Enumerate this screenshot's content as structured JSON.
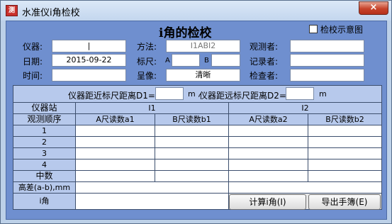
{
  "window": {
    "title": "水准仪i角检校",
    "icon": "app-logo-icon",
    "close_label": "×"
  },
  "form": {
    "title": "i角的检校",
    "diagram_checkbox_label": "检校示意图",
    "instrument_label": "仪器:",
    "instrument_value": "|",
    "method_label": "方法:",
    "method_value": "I1ABI2",
    "observer_label": "观测者:",
    "observer_value": "",
    "date_label": "日期:",
    "date_value": "2015-09-22",
    "staff_label": "标尺:",
    "staff_a_label": "A",
    "staff_a_value": "",
    "staff_b_label": "B",
    "staff_b_value": "",
    "recorder_label": "记录者:",
    "recorder_value": "",
    "time_label": "时间:",
    "time_value": "",
    "image_label": "呈像:",
    "image_value": "清晰",
    "checker_label": "检查者:",
    "checker_value": ""
  },
  "grid": {
    "distance_label": "仪器距近标尺距离D1=",
    "d1_value": "",
    "distance_unit1": "m ,",
    "distance_far_label": "仪器距远标尺距离D2=",
    "d2_value": "",
    "distance_unit2": "m",
    "station_label": "仪器站",
    "i1_label": "I1",
    "i2_label": "I2",
    "order_label": "观测顺序",
    "col_a1": "A尺读数a1",
    "col_b1": "B尺读数b1",
    "col_a2": "A尺读数a2",
    "col_b2": "B尺读数b2",
    "rows": [
      "1",
      "2",
      "3",
      "4"
    ],
    "mean_label": "中数",
    "diff_label": "高差(a-b),mm",
    "i_angle_label": "i角"
  },
  "buttons": {
    "calc_label": "计算i角(I)",
    "export_label": "导出手簿(E)"
  },
  "colors": {
    "client_bg": "#6f8fcf",
    "header_cell": "#b7c9ec",
    "title_bar": "#c3d6ee",
    "close": "#c7432a"
  }
}
